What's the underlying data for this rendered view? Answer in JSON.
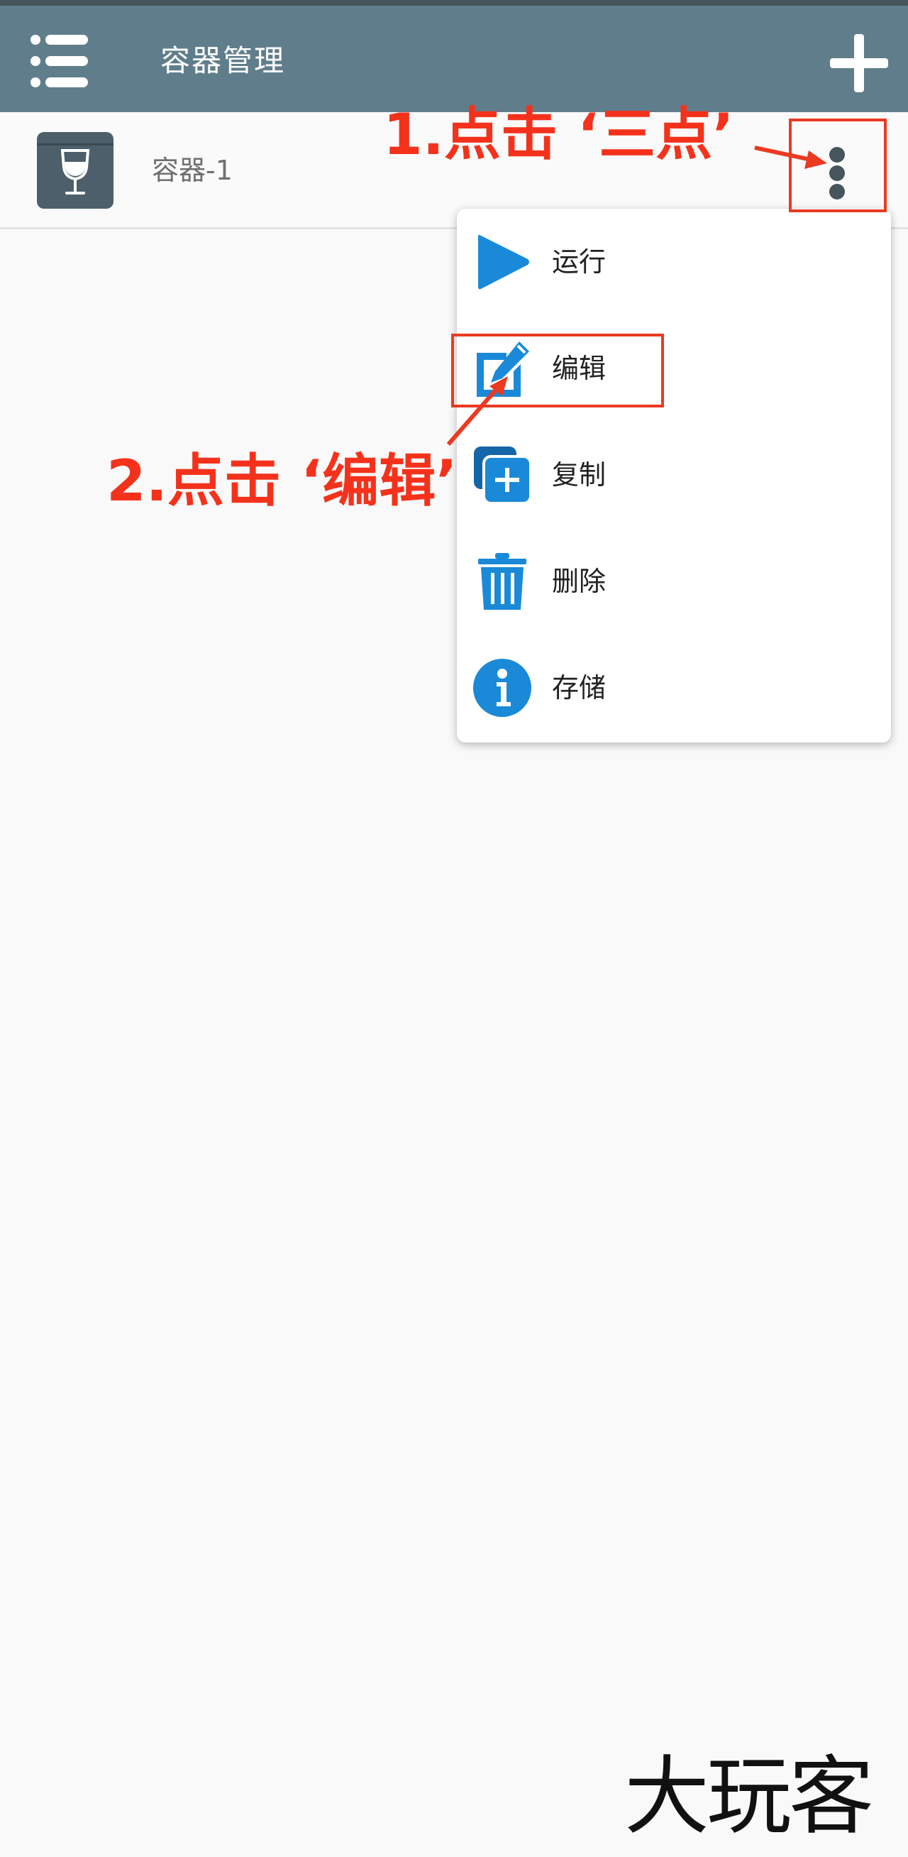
{
  "app": {
    "title": "容器管理",
    "theme_color": "#607d8b"
  },
  "toolbar": {
    "menu_icon": "list-menu-icon",
    "add_icon": "plus-icon"
  },
  "containers": [
    {
      "name": "容器-1",
      "icon": "wine-glass-box-icon",
      "more_icon": "vertical-dots-icon"
    }
  ],
  "context_menu": {
    "items": [
      {
        "label": "运行",
        "icon": "play-icon"
      },
      {
        "label": "编辑",
        "icon": "edit-icon"
      },
      {
        "label": "复制",
        "icon": "copy-icon"
      },
      {
        "label": "删除",
        "icon": "trash-icon"
      },
      {
        "label": "存储",
        "icon": "info-icon"
      }
    ],
    "icon_color": "#1a8ad8"
  },
  "annotations": {
    "step1": "1.点击 ‘三点’",
    "step2": "2.点击 ‘编辑’",
    "color": "#f4321c"
  },
  "watermark": "大玩客"
}
